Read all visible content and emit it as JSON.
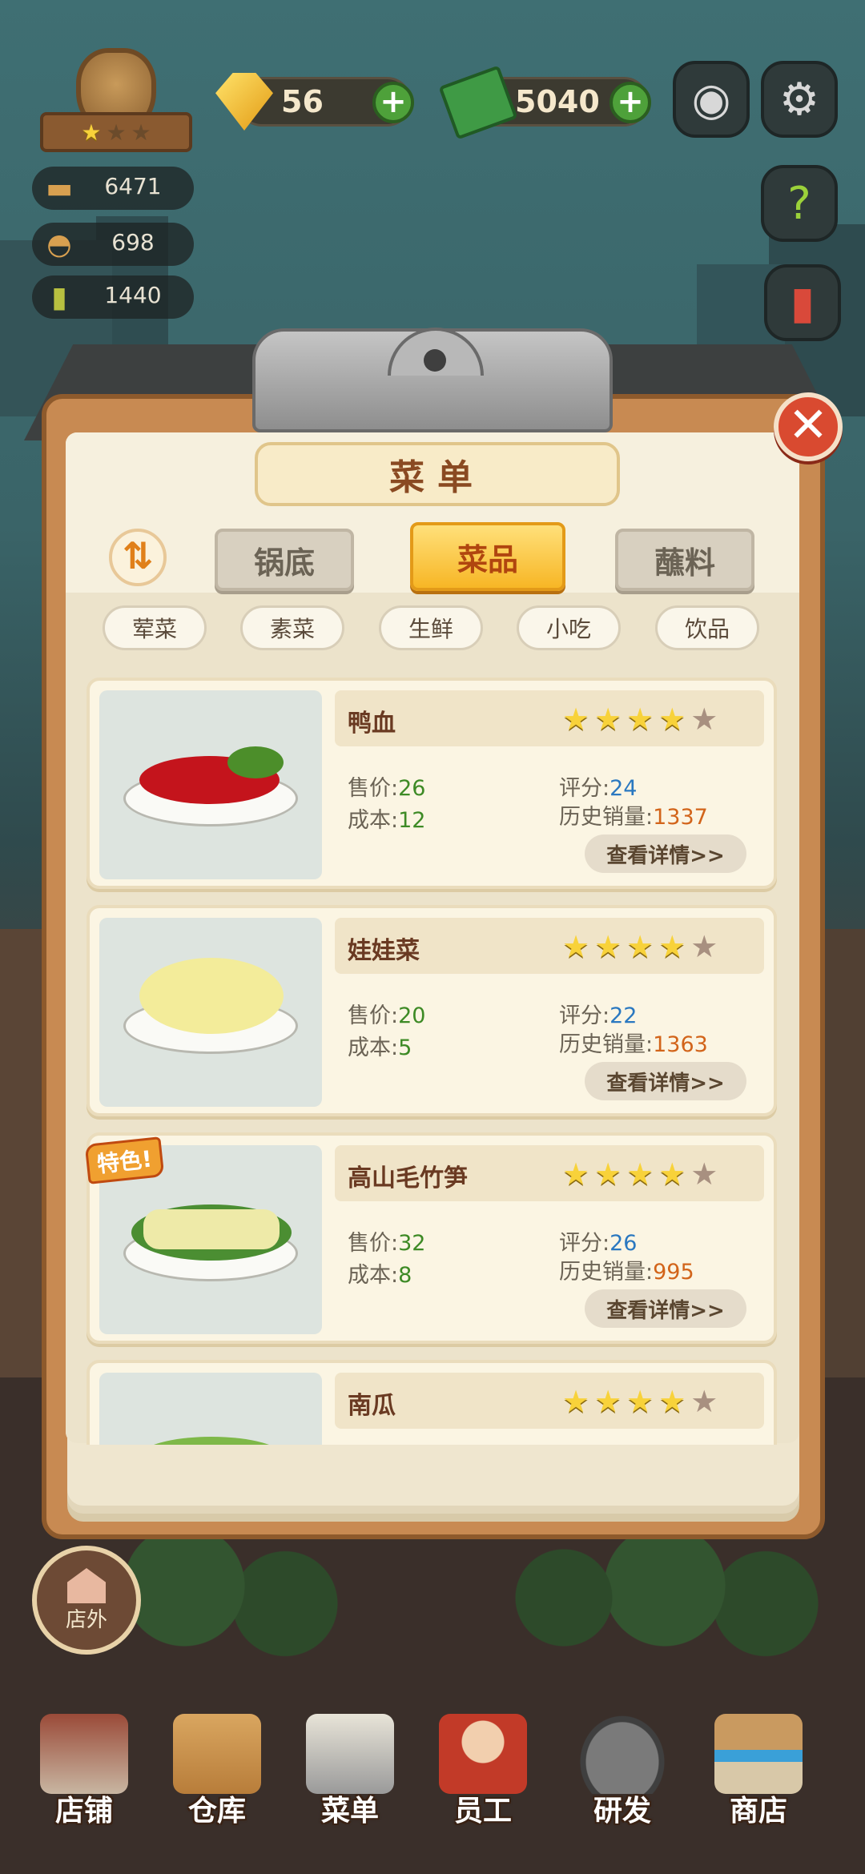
{
  "hud": {
    "gems": "56",
    "cash": "5040",
    "stats": [
      {
        "icon": "pot-icon",
        "value": "6471"
      },
      {
        "icon": "cloche-icon",
        "value": "698"
      },
      {
        "icon": "recipe-book-icon",
        "value": "1440"
      }
    ]
  },
  "menu": {
    "title": "菜单",
    "sort_icon": "⇅",
    "close_icon": "✕",
    "tabs": [
      {
        "label": "锅底",
        "active": false
      },
      {
        "label": "菜品",
        "active": true
      },
      {
        "label": "蘸料",
        "active": false
      }
    ],
    "filters": [
      "荤菜",
      "素菜",
      "生鲜",
      "小吃",
      "饮品"
    ],
    "field_labels": {
      "price": "售价:",
      "cost": "成本:",
      "rating": "评分:",
      "sales": "历史销量:",
      "detail_button": "查看详情>>"
    },
    "dishes": [
      {
        "name": "鸭血",
        "stars": 4,
        "max_stars": 5,
        "price": "26",
        "cost": "12",
        "rating": "24",
        "sales": "1337",
        "special": false
      },
      {
        "name": "娃娃菜",
        "stars": 4,
        "max_stars": 5,
        "price": "20",
        "cost": "5",
        "rating": "22",
        "sales": "1363",
        "special": false
      },
      {
        "name": "高山毛竹笋",
        "stars": 4,
        "max_stars": 5,
        "price": "32",
        "cost": "8",
        "rating": "26",
        "sales": "995",
        "special": true,
        "special_label": "特色!"
      },
      {
        "name": "南瓜",
        "stars": 4,
        "max_stars": 5,
        "special": false
      }
    ]
  },
  "outdoor_button": {
    "label": "店外"
  },
  "bottom_nav": [
    {
      "label": "店铺",
      "icon": "shop-building-icon"
    },
    {
      "label": "仓库",
      "icon": "warehouse-boxes-icon"
    },
    {
      "label": "菜单",
      "icon": "menu-clipboard-icon"
    },
    {
      "label": "员工",
      "icon": "staff-chef-icon"
    },
    {
      "label": "研发",
      "icon": "research-wok-icon"
    },
    {
      "label": "商店",
      "icon": "store-icon"
    }
  ],
  "colors": {
    "active_tab": "#f7b625",
    "price_value": "#3d8a25",
    "rating_value": "#2a78c0",
    "sales_value": "#d2641a",
    "star_on": "#f8d23a",
    "star_off": "#a89080"
  }
}
